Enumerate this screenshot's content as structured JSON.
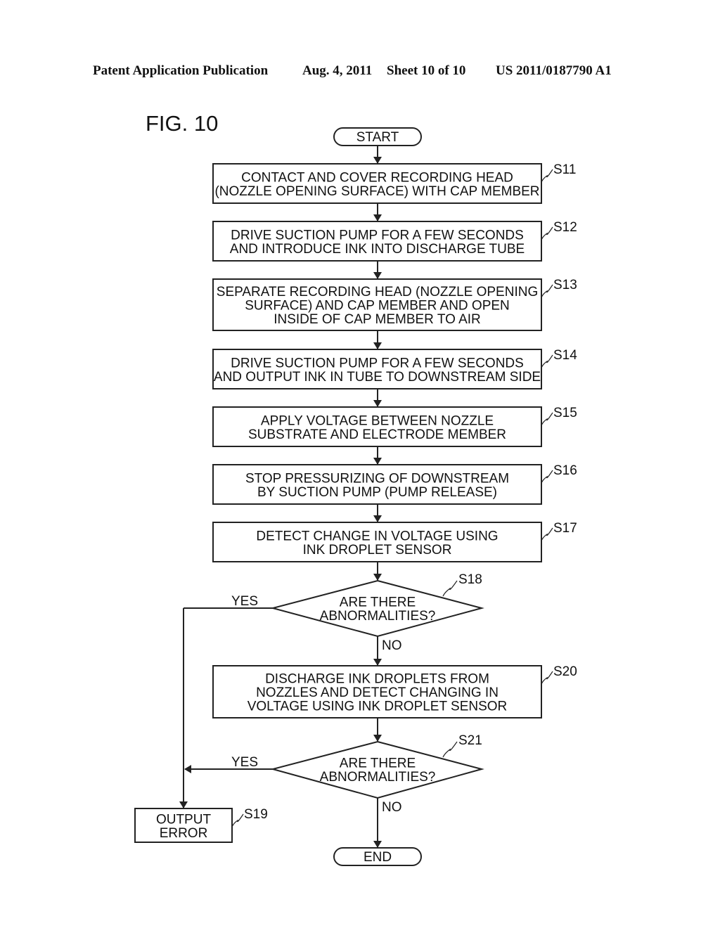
{
  "header": {
    "publication": "Patent Application Publication",
    "date": "Aug. 4, 2011",
    "sheet": "Sheet 10 of 10",
    "number": "US 2011/0187790 A1"
  },
  "figure_label": "FIG. 10",
  "flowchart": {
    "start": "START",
    "end": "END",
    "steps": [
      {
        "id": "S11",
        "lines": [
          "CONTACT AND COVER RECORDING HEAD",
          "(NOZZLE OPENING SURFACE) WITH CAP MEMBER"
        ]
      },
      {
        "id": "S12",
        "lines": [
          "DRIVE SUCTION PUMP FOR A FEW SECONDS",
          "AND INTRODUCE INK INTO DISCHARGE TUBE"
        ]
      },
      {
        "id": "S13",
        "lines": [
          "SEPARATE RECORDING HEAD (NOZZLE OPENING",
          "SURFACE) AND CAP MEMBER AND OPEN",
          "INSIDE OF CAP MEMBER TO AIR"
        ]
      },
      {
        "id": "S14",
        "lines": [
          "DRIVE SUCTION PUMP FOR A FEW SECONDS",
          "AND OUTPUT INK IN TUBE TO DOWNSTREAM SIDE"
        ]
      },
      {
        "id": "S15",
        "lines": [
          "APPLY VOLTAGE BETWEEN NOZZLE",
          "SUBSTRATE AND ELECTRODE MEMBER"
        ]
      },
      {
        "id": "S16",
        "lines": [
          "STOP PRESSURIZING OF DOWNSTREAM",
          "BY SUCTION PUMP (PUMP RELEASE)"
        ]
      },
      {
        "id": "S17",
        "lines": [
          "DETECT CHANGE IN VOLTAGE USING",
          "INK DROPLET SENSOR"
        ]
      },
      {
        "id": "S20",
        "lines": [
          "DISCHARGE INK DROPLETS FROM",
          "NOZZLES AND DETECT CHANGING IN",
          "VOLTAGE USING INK DROPLET SENSOR"
        ]
      },
      {
        "id": "S19",
        "lines": [
          "OUTPUT",
          "ERROR"
        ]
      }
    ],
    "decisions": [
      {
        "id": "S18",
        "lines": [
          "ARE THERE",
          "ABNORMALITIES?"
        ],
        "yes": "YES",
        "no": "NO"
      },
      {
        "id": "S21",
        "lines": [
          "ARE THERE",
          "ABNORMALITIES?"
        ],
        "yes": "YES",
        "no": "NO"
      }
    ]
  }
}
